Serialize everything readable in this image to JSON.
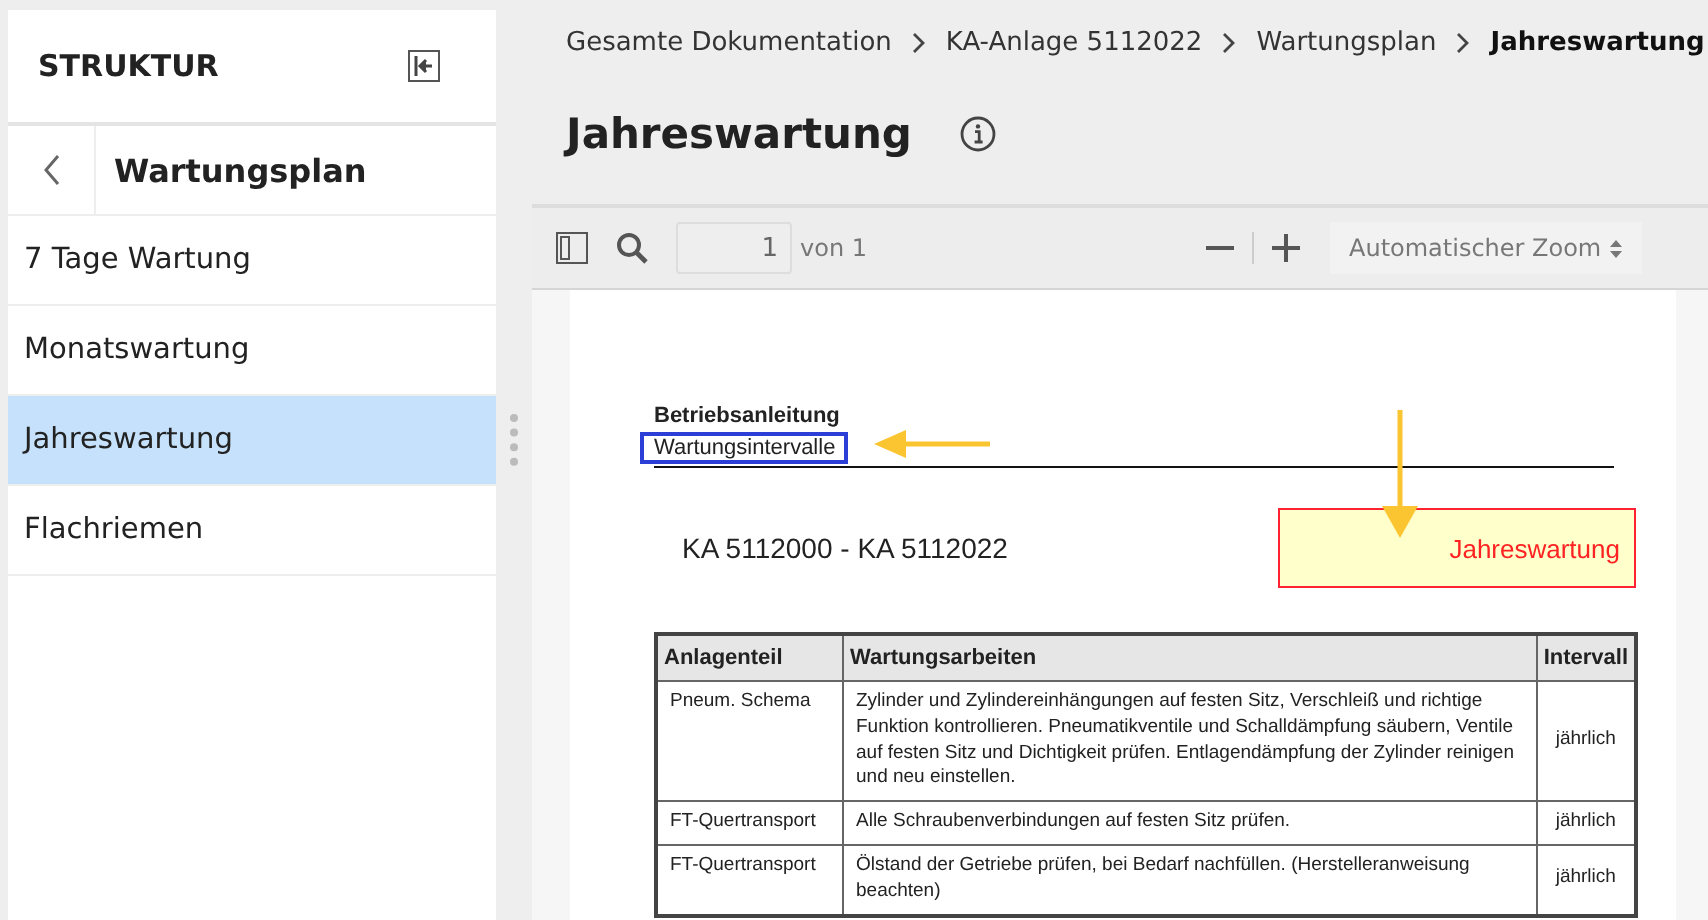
{
  "sidebar": {
    "title": "STRUKTUR",
    "back_title": "Wartungsplan",
    "items": [
      {
        "label": "7 Tage Wartung",
        "selected": false
      },
      {
        "label": "Monatswartung",
        "selected": false
      },
      {
        "label": "Jahreswartung",
        "selected": true
      },
      {
        "label": "Flachriemen",
        "selected": false
      }
    ]
  },
  "breadcrumb": [
    "Gesamte Dokumentation",
    "KA-Anlage 5112022",
    "Wartungsplan",
    "Jahreswartung"
  ],
  "title": "Jahreswartung",
  "viewer": {
    "page_number": "1",
    "page_count": "von 1",
    "zoom": "Automatischer Zoom"
  },
  "document": {
    "heading": "Betriebsanleitung",
    "subheading": "Wartungsintervalle",
    "range": "KA 5112000 - KA 5112022",
    "interval_box": "Jahreswartung",
    "table": {
      "columns": [
        "Anlagenteil",
        "Wartungsarbeiten",
        "Intervall"
      ],
      "rows": [
        [
          "Pneum. Schema",
          "Zylinder und Zylindereinhängungen auf festen Sitz, Verschleiß und richtige Funktion kontrollieren. Pneumatikventile und Schalldämpfung säubern, Ventile auf festen Sitz und Dichtigkeit prüfen. Entlagendämpfung der Zylinder reinigen und neu einstellen.",
          "jährlich"
        ],
        [
          "FT-Quertransport",
          "Alle Schraubenverbindungen auf festen Sitz prüfen.",
          "jährlich"
        ],
        [
          "FT-Quertransport",
          "Ölstand der Getriebe prüfen, bei Bedarf nachfüllen. (Herstelleranweisung beachten)",
          "jährlich"
        ]
      ]
    }
  }
}
